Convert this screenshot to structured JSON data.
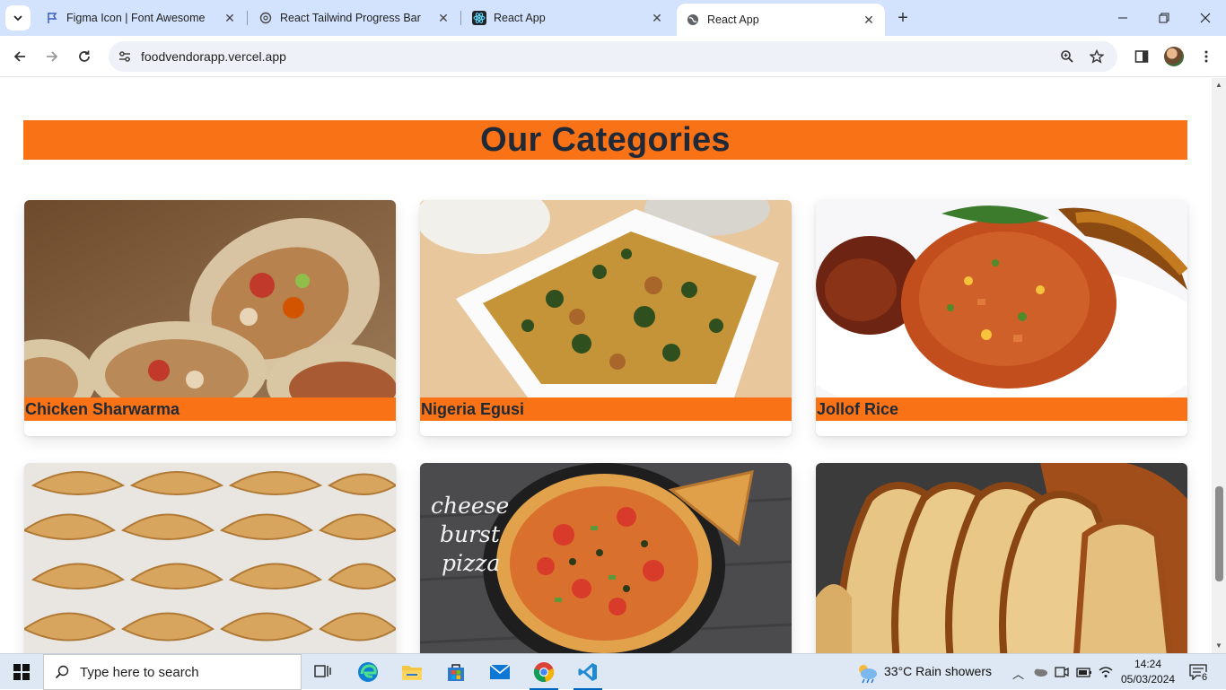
{
  "browser": {
    "tabs": [
      {
        "title": "Figma Icon | Font Awesome",
        "icon": "flag-icon"
      },
      {
        "title": "React Tailwind Progress Bar",
        "icon": "openai-icon"
      },
      {
        "title": "React App",
        "icon": "react-icon"
      },
      {
        "title": "React App",
        "icon": "globe-icon",
        "active": true
      }
    ],
    "url": "foodvendorapp.vercel.app"
  },
  "page": {
    "section_title": "Our Categories",
    "categories": [
      {
        "name": "Chicken Sharwarma"
      },
      {
        "name": "Nigeria Egusi"
      },
      {
        "name": "Jollof Rice"
      },
      {
        "name": ""
      },
      {
        "name": "",
        "image_text": "cheese burst pizza"
      },
      {
        "name": ""
      }
    ],
    "colors": {
      "accent": "#f97316",
      "heading": "#1f2937"
    }
  },
  "taskbar": {
    "search_placeholder": "Type here to search",
    "weather": "33°C  Rain showers",
    "time": "14:24",
    "date": "05/03/2024",
    "notification_count": "6"
  }
}
